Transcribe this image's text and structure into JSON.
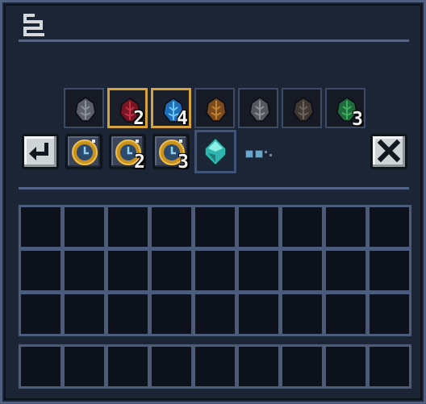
{
  "header": {
    "icon": "sort-menu-icon"
  },
  "ingredients": [
    {
      "name": "gray-spiked-ingredient-icon",
      "color": "#5a5f6b",
      "accent": "#8d919c",
      "selected": false,
      "qty": ""
    },
    {
      "name": "red-spiked-ingredient-icon",
      "color": "#7a1423",
      "accent": "#c23347",
      "selected": true,
      "qty": "2"
    },
    {
      "name": "blue-crystal-ingredient-icon",
      "color": "#1e6fb8",
      "accent": "#6cc8f2",
      "selected": true,
      "qty": "4"
    },
    {
      "name": "brown-seed-ingredient-icon",
      "color": "#7b4a1e",
      "accent": "#c2842f",
      "selected": false,
      "qty": ""
    },
    {
      "name": "steel-shield-ingredient-icon",
      "color": "#55595f",
      "accent": "#8b9097",
      "selected": false,
      "qty": ""
    },
    {
      "name": "dark-root-ingredient-icon",
      "color": "#3e3733",
      "accent": "#6e625a",
      "selected": false,
      "qty": ""
    },
    {
      "name": "green-leaf-ingredient-icon",
      "color": "#1f6b3c",
      "accent": "#3fae5f",
      "selected": false,
      "qty": "3"
    }
  ],
  "recipe": {
    "back_icon": "return-arrow-icon",
    "timers": [
      {
        "name": "gold-timer-icon",
        "qty": ""
      },
      {
        "name": "gold-timer-icon",
        "qty": "2"
      },
      {
        "name": "gold-timer-icon",
        "qty": "3"
      }
    ],
    "result": {
      "name": "cyan-gem-result-icon",
      "color": "#2fb5b0",
      "accent": "#8ef0e6"
    },
    "progress_dots": {
      "filled": 2,
      "empty": 2
    },
    "close_icon": "close-x-icon"
  },
  "inventory": {
    "rows": 3,
    "cols": 9
  },
  "hotbar": {
    "cols": 9
  },
  "colors": {
    "panel": "#1c2535",
    "border": "#4f5f80",
    "selected": "#d6a33a",
    "cell": "#0d111b"
  }
}
